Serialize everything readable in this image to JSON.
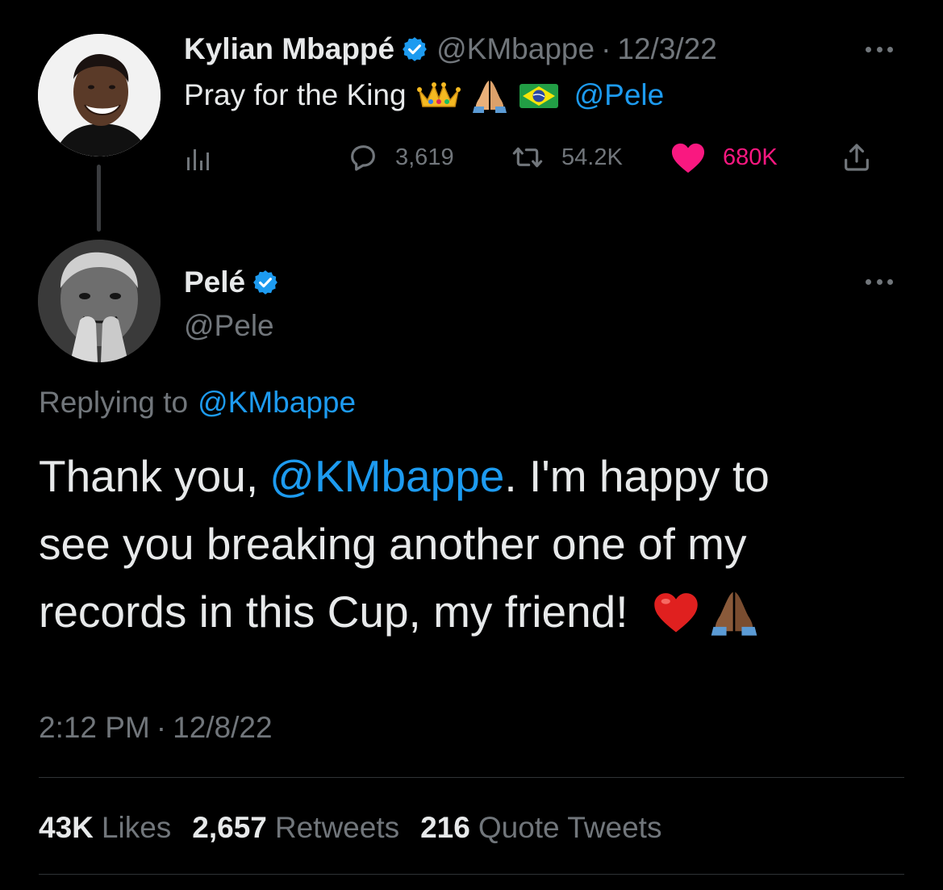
{
  "colors": {
    "background": "#000000",
    "text_primary": "#e7e9ea",
    "text_secondary": "#71767b",
    "accent_blue": "#1d9bf0",
    "like_pink": "#f91880",
    "divider": "#2f3336"
  },
  "parent_tweet": {
    "author_name": "Kylian Mbappé",
    "verified": true,
    "handle": "@KMbappe",
    "separator": "·",
    "date": "12/3/22",
    "text": "Pray for the King",
    "emojis": [
      "crown-emoji",
      "folded-hands-emoji",
      "brazil-flag-emoji"
    ],
    "mention": "@Pele",
    "actions": {
      "analytics_icon": "analytics-icon",
      "replies": "3,619",
      "retweets": "54.2K",
      "likes": "680K",
      "liked": true,
      "share_icon": "share-icon"
    }
  },
  "main_tweet": {
    "author_name": "Pelé",
    "verified": true,
    "handle": "@Pele",
    "replying_to_label": "Replying to",
    "replying_to_handle": "@KMbappe",
    "body": {
      "line1_before": "Thank you,",
      "line1_mention": "@KMbappe",
      "line1_after": ". I'm happy to",
      "line2": "see you breaking another one of my",
      "line3": "records in this Cup, my friend!",
      "emojis": [
        "red-heart-emoji",
        "folded-hands-emoji"
      ]
    },
    "time": "2:12 PM",
    "separator": "·",
    "date": "12/8/22",
    "stats": {
      "likes_count": "43K",
      "likes_label": "Likes",
      "retweets_count": "2,657",
      "retweets_label": "Retweets",
      "quotes_count": "216",
      "quotes_label": "Quote Tweets"
    }
  }
}
